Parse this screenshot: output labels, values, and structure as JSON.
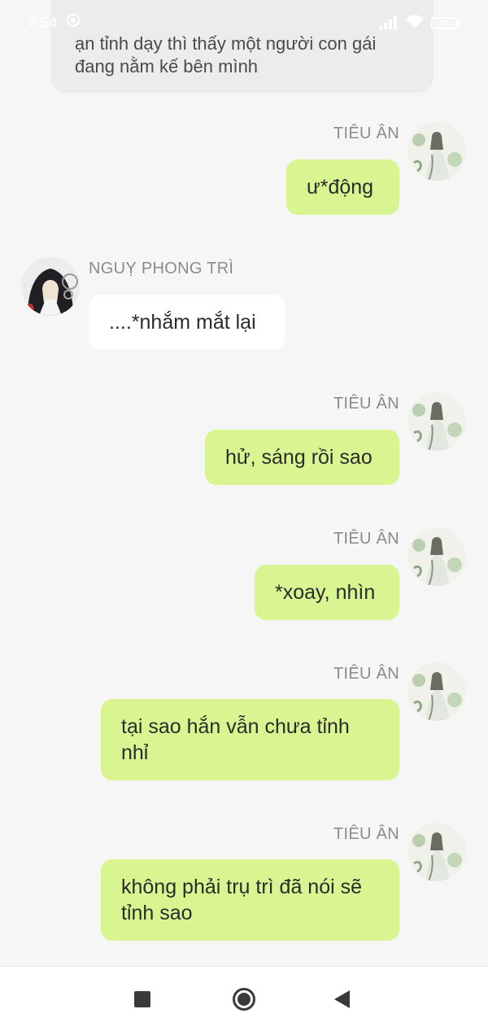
{
  "status_bar": {
    "time": "7:54",
    "battery": "31",
    "icons": [
      "sync-icon",
      "signal-icon",
      "wifi-icon",
      "battery-icon"
    ]
  },
  "chat": {
    "narration": {
      "lines": [
        "ạn tỉnh dạy thì thấy một người con gái",
        "đang nằm kế bên mình"
      ]
    },
    "messages": [
      {
        "sender": "TIÊU ÂN",
        "side": "right",
        "text": "ư*động"
      },
      {
        "sender": "NGUỴ PHONG TRÌ",
        "side": "left",
        "text": "....*nhắm mắt lại"
      },
      {
        "sender": "TIÊU ÂN",
        "side": "right",
        "text": "hử, sáng rồi sao"
      },
      {
        "sender": "TIÊU ÂN",
        "side": "right",
        "text": "*xoay, nhìn"
      },
      {
        "sender": "TIÊU ÂN",
        "side": "right",
        "lines": [
          "tại sao hắn vẫn chưa tỉnh",
          "nhỉ"
        ]
      },
      {
        "sender": "TIÊU ÂN",
        "side": "right",
        "lines": [
          "không phải trụ trì đã nói sẽ",
          "tỉnh sao"
        ]
      }
    ]
  },
  "colors": {
    "background": "#f6f6f6",
    "my_bubble": "#d8f592",
    "other_bubble": "#ffffff",
    "narration_bubble": "#ececec",
    "sender_name": "#8b8b8b"
  },
  "nav_bar": {
    "icons": [
      "recent-apps-icon",
      "home-icon",
      "back-icon"
    ]
  }
}
